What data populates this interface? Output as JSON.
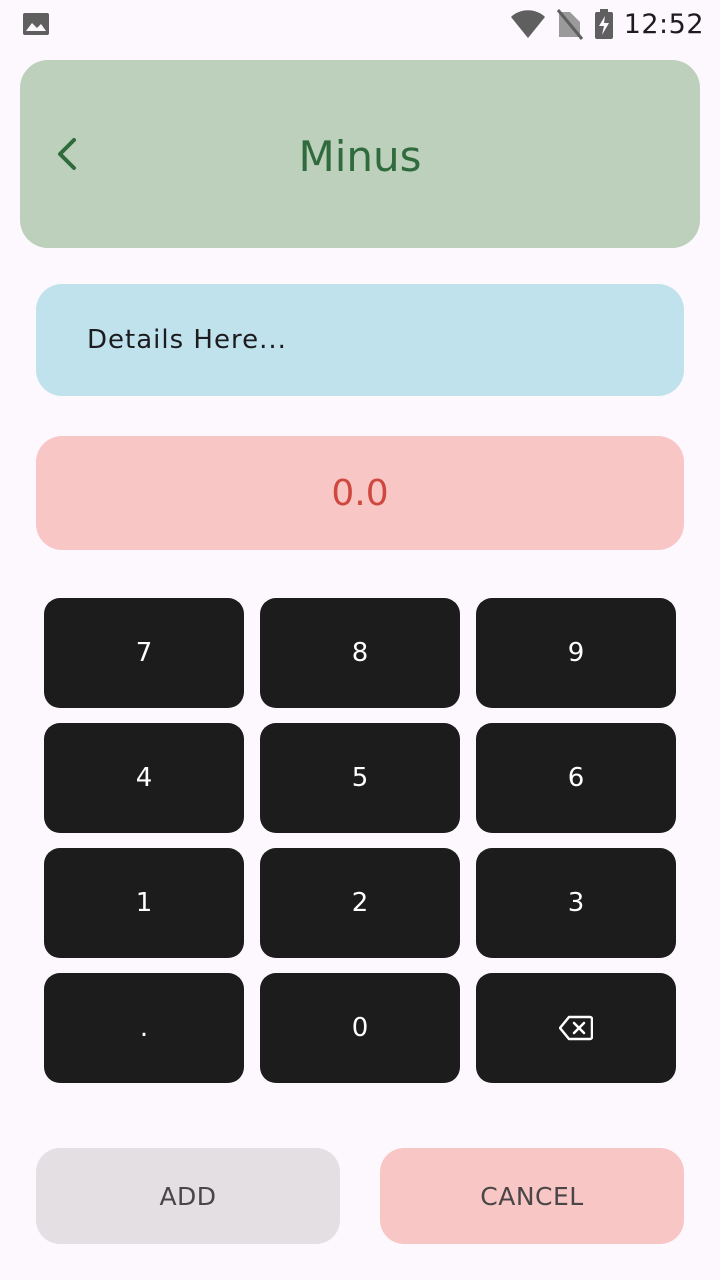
{
  "status_bar": {
    "left_icon": "image-icon",
    "icons": [
      "wifi-icon",
      "no-sim-icon",
      "battery-charging-icon"
    ],
    "time": "12:52"
  },
  "header": {
    "back_icon": "chevron-left-icon",
    "title": "Minus",
    "background": "#bcd0bb",
    "title_color": "#2f6b3d"
  },
  "details": {
    "placeholder": "Details Here...",
    "background": "#bfe2ec"
  },
  "amount": {
    "value": "0.0",
    "background": "#f8c6c4",
    "color": "#d0473e"
  },
  "keypad": {
    "keys": [
      {
        "label": "7"
      },
      {
        "label": "8"
      },
      {
        "label": "9"
      },
      {
        "label": "4"
      },
      {
        "label": "5"
      },
      {
        "label": "6"
      },
      {
        "label": "1"
      },
      {
        "label": "2"
      },
      {
        "label": "3"
      },
      {
        "label": "."
      },
      {
        "label": "0"
      },
      {
        "label": "",
        "icon": "backspace-icon"
      }
    ],
    "background": "#1c1c1c"
  },
  "actions": {
    "add_label": "ADD",
    "cancel_label": "CANCEL"
  }
}
